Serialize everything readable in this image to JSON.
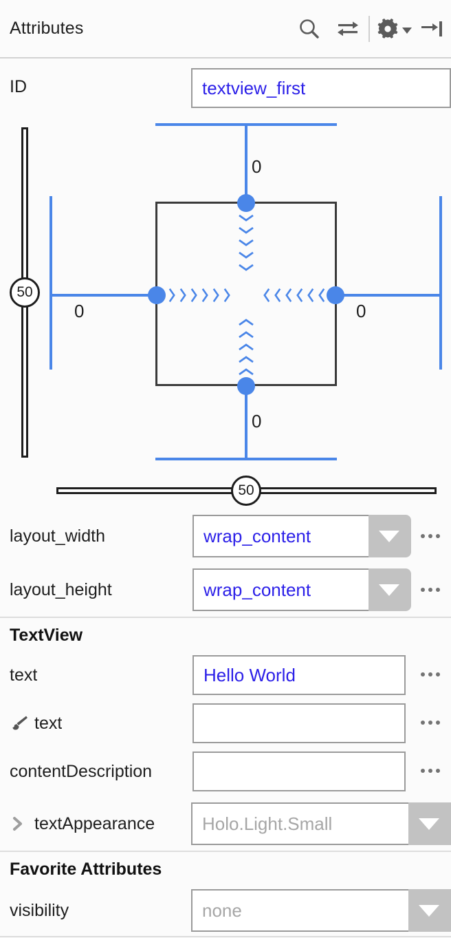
{
  "panel": {
    "title": "Attributes",
    "toolbar": [
      {
        "name": "search-icon",
        "label": "Search"
      },
      {
        "name": "swap-arrows-icon",
        "label": "Toggle view"
      },
      {
        "name": "gear-icon",
        "label": "Settings"
      },
      {
        "name": "collapse-panel-icon",
        "label": "Hide"
      }
    ]
  },
  "id_row": {
    "label": "ID",
    "value": "textview_first"
  },
  "constraint_widget": {
    "margin_top": "0",
    "margin_left": "0",
    "margin_right": "0",
    "margin_bottom": "0",
    "vertical_bias": "50",
    "horizontal_bias": "50",
    "width_mode": "wrap_content",
    "height_mode": "wrap_content",
    "accent_color": "#4a86e8",
    "box_color": "#3a3a3a"
  },
  "layout_rows": [
    {
      "label": "layout_width",
      "value": "wrap_content",
      "control": "combo",
      "has_ellipsis": true
    },
    {
      "label": "layout_height",
      "value": "wrap_content",
      "control": "combo",
      "has_ellipsis": true
    }
  ],
  "textview_section": {
    "header": "TextView",
    "rows": [
      {
        "label": "text",
        "value": "Hello World",
        "control": "text",
        "icon": null,
        "has_ellipsis": true,
        "placeholder": false
      },
      {
        "label": "text",
        "value": "",
        "control": "text",
        "icon": "paintbrush-icon",
        "has_ellipsis": true,
        "placeholder": false
      },
      {
        "label": "contentDescription",
        "value": "",
        "control": "text",
        "icon": null,
        "has_ellipsis": true,
        "placeholder": false
      },
      {
        "label": "textAppearance",
        "value": "Holo.Light.Small",
        "control": "combo",
        "icon": "expander-chevron-icon",
        "has_ellipsis": false,
        "placeholder": true
      }
    ]
  },
  "favorites_section": {
    "header": "Favorite Attributes",
    "rows": [
      {
        "label": "visibility",
        "value": "none",
        "control": "combo",
        "has_ellipsis": false,
        "placeholder": true
      }
    ]
  }
}
